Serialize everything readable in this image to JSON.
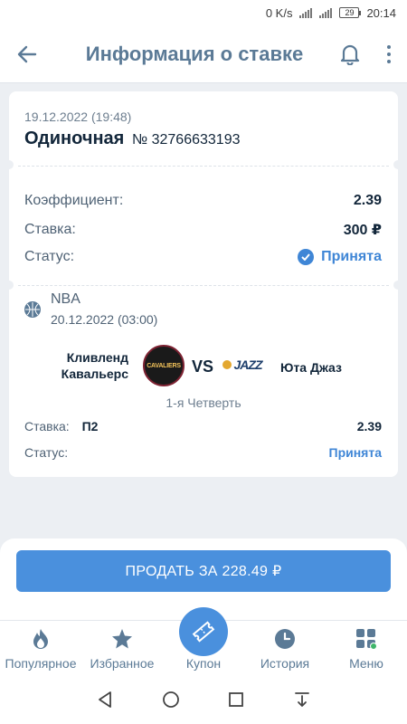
{
  "status_bar": {
    "speed": "0 K/s",
    "network": "4G",
    "battery": "29",
    "time": "20:14"
  },
  "header": {
    "title": "Информация о ставке"
  },
  "bet": {
    "date": "19.12.2022 (19:48)",
    "type": "Одиночная",
    "number": "№ 32766633193",
    "coef_label": "Коэффициент:",
    "coef_value": "2.39",
    "stake_label": "Ставка:",
    "stake_value": "300 ₽",
    "status_label": "Статус:",
    "status_value": "Принята"
  },
  "event": {
    "league": "NBA",
    "date": "20.12.2022 (03:00)",
    "team1": "Кливленд Кавальерс",
    "team1_logo_text": "CAVALIERS",
    "vs": "VS",
    "team2_logo_text": "JAZZ",
    "team2": "Юта Джаз",
    "period": "1-я Четверть",
    "stake_label": "Ставка:",
    "pick": "П2",
    "odds": "2.39",
    "status_label": "Статус:",
    "status_value": "Принята"
  },
  "sell_button": {
    "label": "ПРОДАТЬ ЗА 228.49 ₽"
  },
  "nav": [
    {
      "label": "Популярное",
      "icon": "flame-icon"
    },
    {
      "label": "Избранное",
      "icon": "star-icon"
    },
    {
      "label": "Купон",
      "icon": "ticket-icon"
    },
    {
      "label": "История",
      "icon": "clock-icon"
    },
    {
      "label": "Меню",
      "icon": "grid-icon"
    }
  ],
  "colors": {
    "accent": "#4a90dd",
    "header_text": "#5b7a96",
    "accepted": "#3f86d6"
  }
}
